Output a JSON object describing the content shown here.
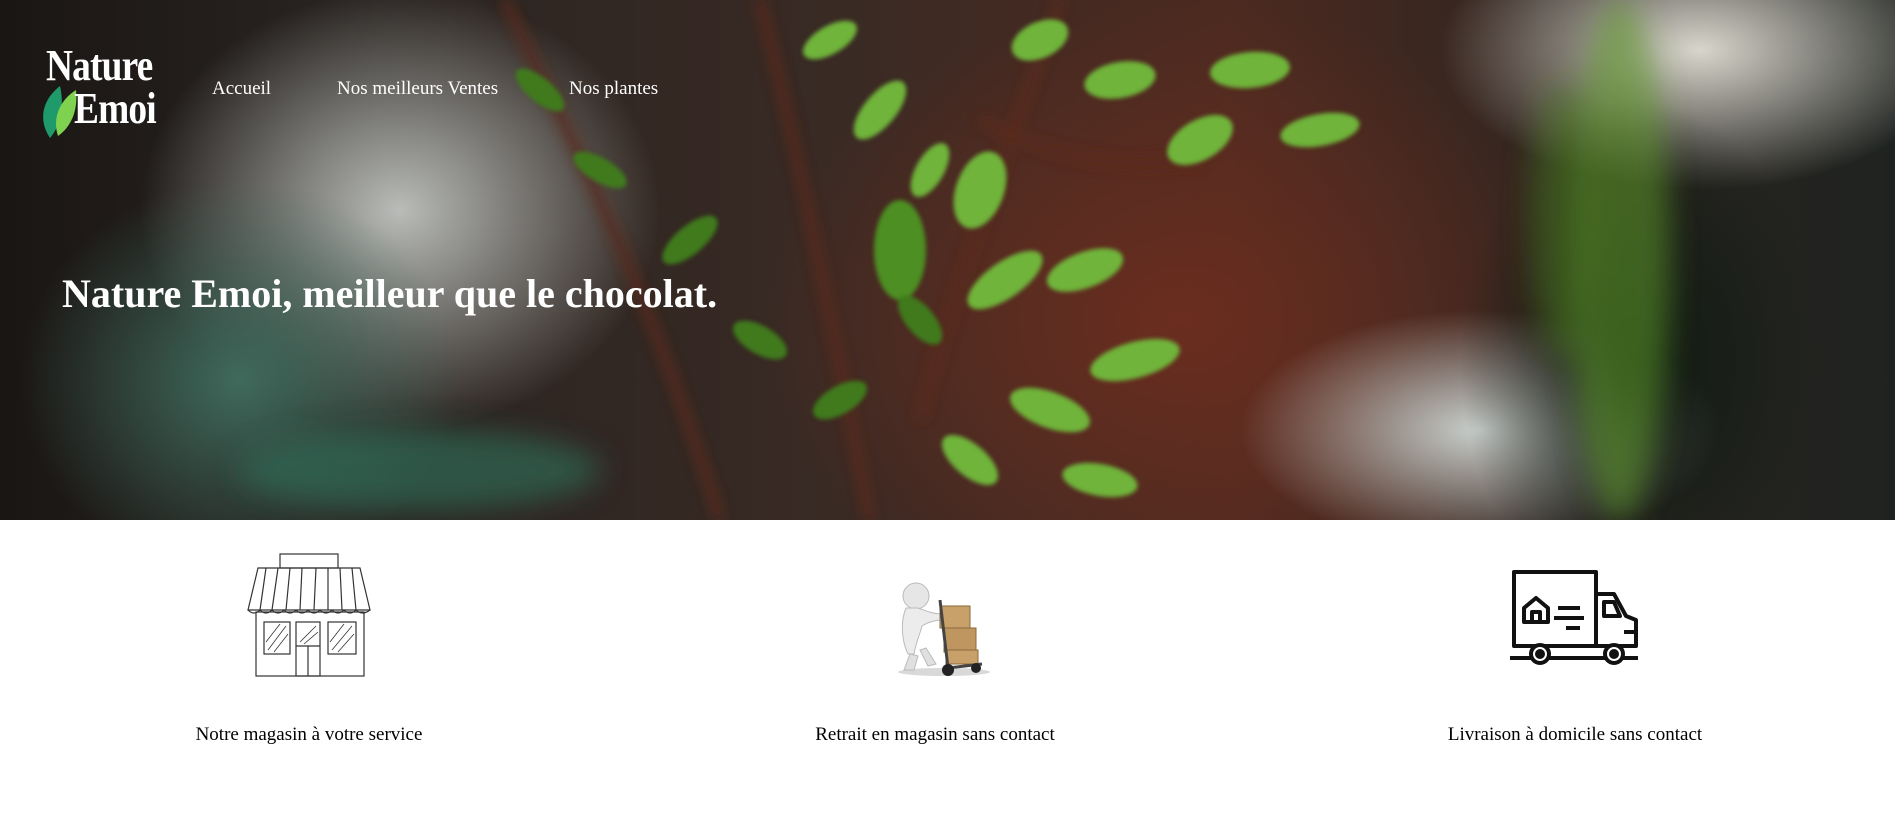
{
  "header": {
    "logo": {
      "line1": "Nature",
      "line2": "Emoi"
    },
    "nav": [
      {
        "label": "Accueil"
      },
      {
        "label": "Nos meilleurs Ventes"
      },
      {
        "label": "Nos plantes"
      }
    ]
  },
  "hero": {
    "title": "Nature Emoi, meilleur que le chocolat."
  },
  "features": [
    {
      "label": "Notre magasin à votre service",
      "icon": "storefront-icon"
    },
    {
      "label": "Retrait en magasin sans contact",
      "icon": "hand-truck-boxes-icon"
    },
    {
      "label": "Livraison à domicile sans contact",
      "icon": "delivery-truck-icon"
    }
  ],
  "colors": {
    "logo_leaf_dark": "#1f9a6a",
    "logo_leaf_light": "#7fd24f",
    "text_light": "#ffffff",
    "text_dark": "#000000"
  }
}
